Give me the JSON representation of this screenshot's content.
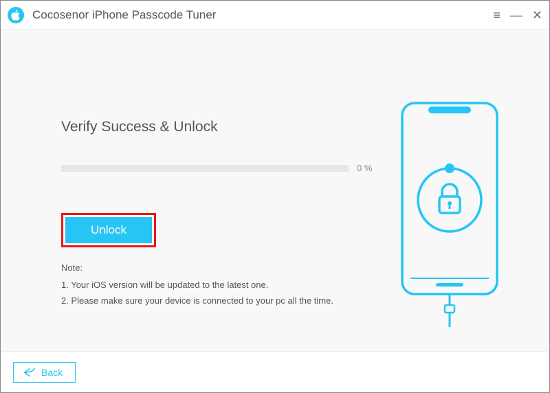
{
  "app": {
    "title": "Cocosenor iPhone Passcode Tuner"
  },
  "main": {
    "heading": "Verify Success & Unlock",
    "progress_percent": "0 %",
    "unlock_label": "Unlock",
    "note_label": "Note:",
    "note_1": "1. Your iOS version will be updated to the latest one.",
    "note_2": "2. Please make sure your device is connected to your pc all the time."
  },
  "footer": {
    "back_label": "Back"
  },
  "colors": {
    "accent": "#26c5f3",
    "highlight_border": "#ef1515"
  }
}
